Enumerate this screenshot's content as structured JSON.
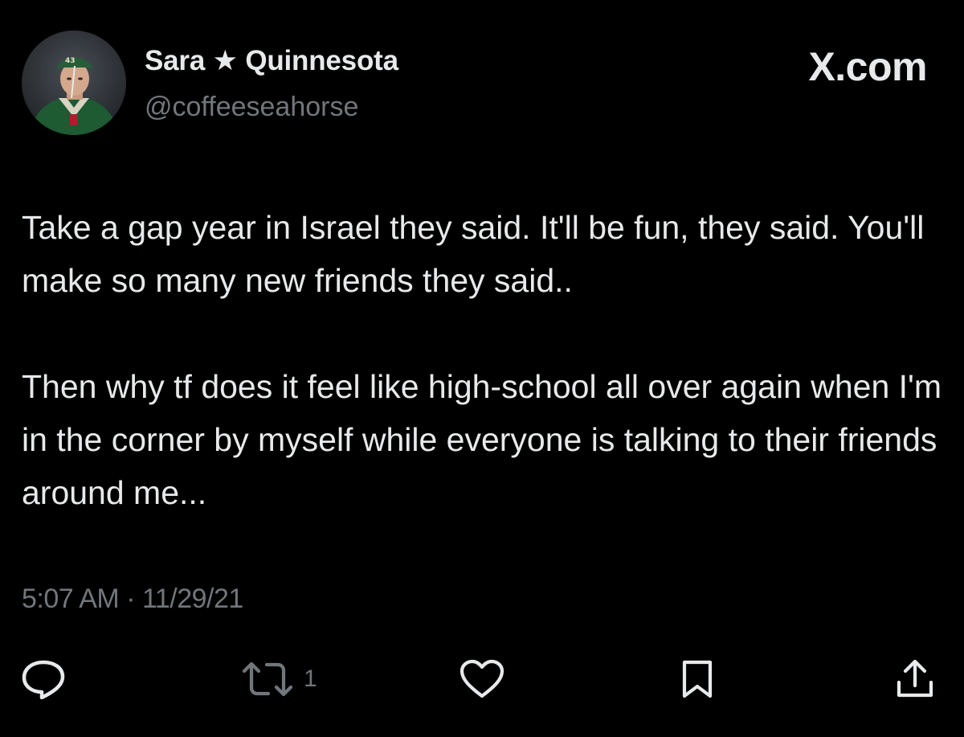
{
  "header": {
    "display_name": "Sara ★ Quinnesota",
    "handle": "@coffeeseahorse",
    "brand": "X.com"
  },
  "tweet": {
    "paragraphs": [
      "Take a gap year in Israel they said. It'll be fun, they said. You'll make so many new friends they said..",
      "Then why tf does it feel like high-school all over again when I'm in the corner by myself while everyone is talking to their friends around me..."
    ],
    "timestamp": "5:07 AM · 11/29/21"
  },
  "actions": {
    "reply_icon": "reply-icon",
    "retweet_icon": "retweet-icon",
    "retweet_count": "1",
    "like_icon": "heart-icon",
    "bookmark_icon": "bookmark-icon",
    "share_icon": "share-icon"
  },
  "colors": {
    "background": "#000000",
    "primary_text": "#e7e9ea",
    "secondary_text": "#71767b"
  }
}
